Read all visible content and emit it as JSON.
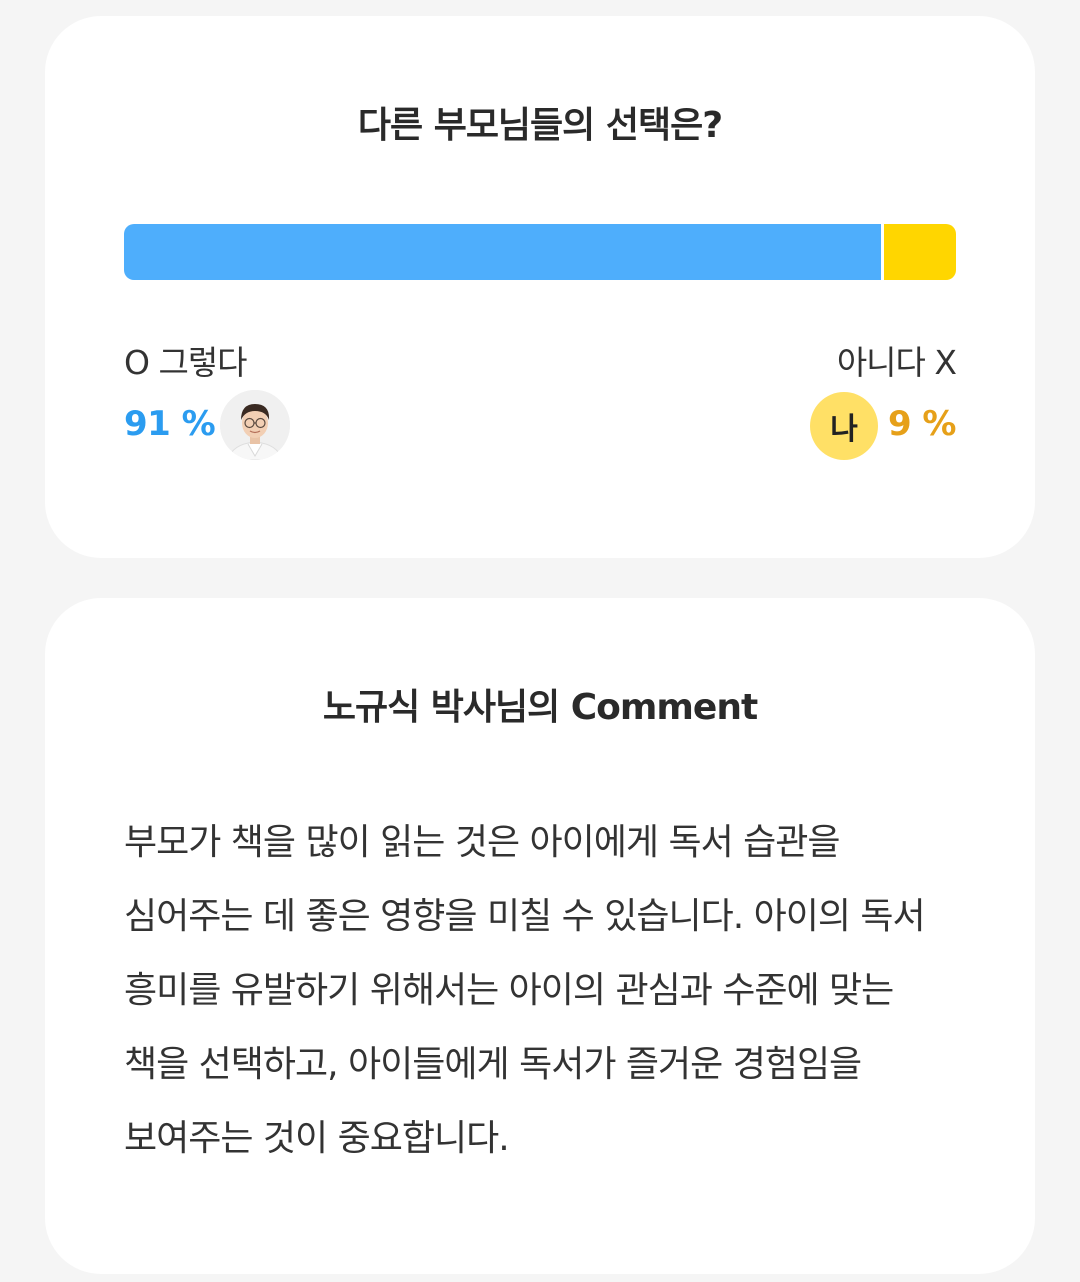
{
  "poll": {
    "title": "다른 부모님들의 선택은?",
    "yes": {
      "label": "O 그렇다",
      "percent_text": "91 %",
      "share": 0.91,
      "color": "#4eaefc",
      "text_color": "#2b9cf0"
    },
    "no": {
      "label": "아니다 X",
      "percent_text": "9 %",
      "share": 0.09,
      "color": "#ffd600",
      "text_color": "#e6a019",
      "me_badge": "나"
    },
    "expert_avatar_icon": "expert-avatar-icon"
  },
  "comment": {
    "title": "노규식 박사님의 Comment",
    "body": "부모가 책을 많이 읽는 것은 아이에게 독서 습관을 심어주는 데 좋은 영향을 미칠 수 있습니다. 아이의 독서 흥미를 유발하기 위해서는 아이의 관심과 수준에 맞는 책을 선택하고, 아이들에게 독서가 즐거운 경험임을 보여주는 것이 중요합니다."
  }
}
